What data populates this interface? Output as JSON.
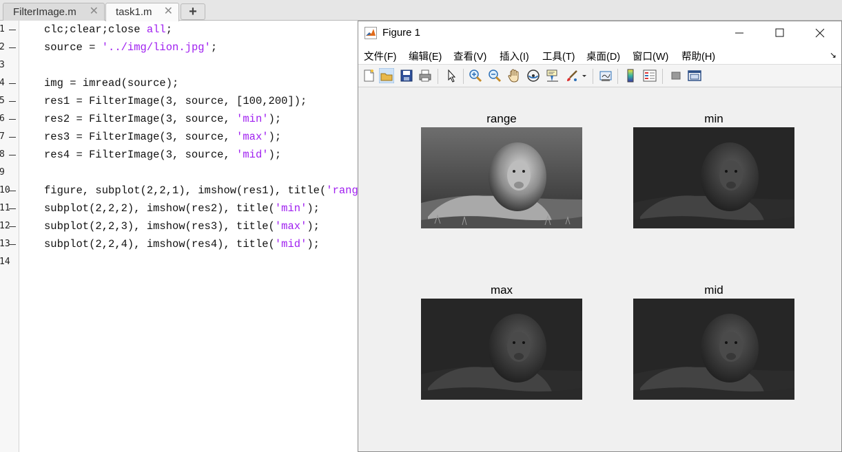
{
  "editor": {
    "tabs": [
      {
        "label": "FilterImage.m",
        "active": false
      },
      {
        "label": "task1.m",
        "active": true
      }
    ],
    "new_tab_label": "+",
    "close_glyph": "✕",
    "line_marker": "—",
    "lines": [
      {
        "num": "1",
        "text": [
          "clc;clear;close ",
          {
            "s": "all"
          },
          ";"
        ],
        "dash": true
      },
      {
        "num": "2",
        "text": [
          "source = ",
          {
            "s": "'../img/lion.jpg'"
          },
          ";"
        ],
        "dash": true
      },
      {
        "num": "3",
        "text": [],
        "dash": false
      },
      {
        "num": "4",
        "text": [
          "img = imread(source);"
        ],
        "dash": true
      },
      {
        "num": "5",
        "text": [
          "res1 = FilterImage(3, source, [100,200]);"
        ],
        "dash": true
      },
      {
        "num": "6",
        "text": [
          "res2 = FilterImage(3, source, ",
          {
            "s": "'min'"
          },
          ");"
        ],
        "dash": true
      },
      {
        "num": "7",
        "text": [
          "res3 = FilterImage(3, source, ",
          {
            "s": "'max'"
          },
          ");"
        ],
        "dash": true
      },
      {
        "num": "8",
        "text": [
          "res4 = FilterImage(3, source, ",
          {
            "s": "'mid'"
          },
          ");"
        ],
        "dash": true
      },
      {
        "num": "9",
        "text": [],
        "dash": false
      },
      {
        "num": "10",
        "text": [
          "figure, subplot(2,2,1), imshow(res1), title(",
          {
            "s": "'range'"
          }
        ],
        "dash": true
      },
      {
        "num": "11",
        "text": [
          "subplot(2,2,2), imshow(res2), title(",
          {
            "s": "'min'"
          },
          ");"
        ],
        "dash": true
      },
      {
        "num": "12",
        "text": [
          "subplot(2,2,3), imshow(res3), title(",
          {
            "s": "'max'"
          },
          ");"
        ],
        "dash": true
      },
      {
        "num": "13",
        "text": [
          "subplot(2,2,4), imshow(res4), title(",
          {
            "s": "'mid'"
          },
          ");"
        ],
        "dash": true
      },
      {
        "num": "14",
        "text": [],
        "dash": false
      }
    ],
    "string_color": "#a020f0"
  },
  "figure": {
    "title": "Figure 1",
    "window_buttons": {
      "minimize": "—",
      "maximize": "☐",
      "close": "✕"
    },
    "menus": [
      "文件(F)",
      "编辑(E)",
      "查看(V)",
      "插入(I)",
      "工具(T)",
      "桌面(D)",
      "窗口(W)",
      "帮助(H)"
    ],
    "menu_overflow": "↘",
    "toolbar_icons": [
      "new-figure-icon",
      "open-file-icon",
      "save-icon",
      "print-icon",
      "pointer-icon",
      "zoom-in-icon",
      "zoom-out-icon",
      "pan-hand-icon",
      "rotate-3d-icon",
      "data-cursor-icon",
      "brush-icon",
      "link-plot-icon",
      "colorbar-icon",
      "legend-icon",
      "hide-plot-tools-icon",
      "show-plot-tools-icon"
    ],
    "subplots": [
      {
        "title": "range",
        "brightness": "bright"
      },
      {
        "title": "min",
        "brightness": "dark"
      },
      {
        "title": "max",
        "brightness": "dark"
      },
      {
        "title": "mid",
        "brightness": "dark"
      }
    ]
  }
}
